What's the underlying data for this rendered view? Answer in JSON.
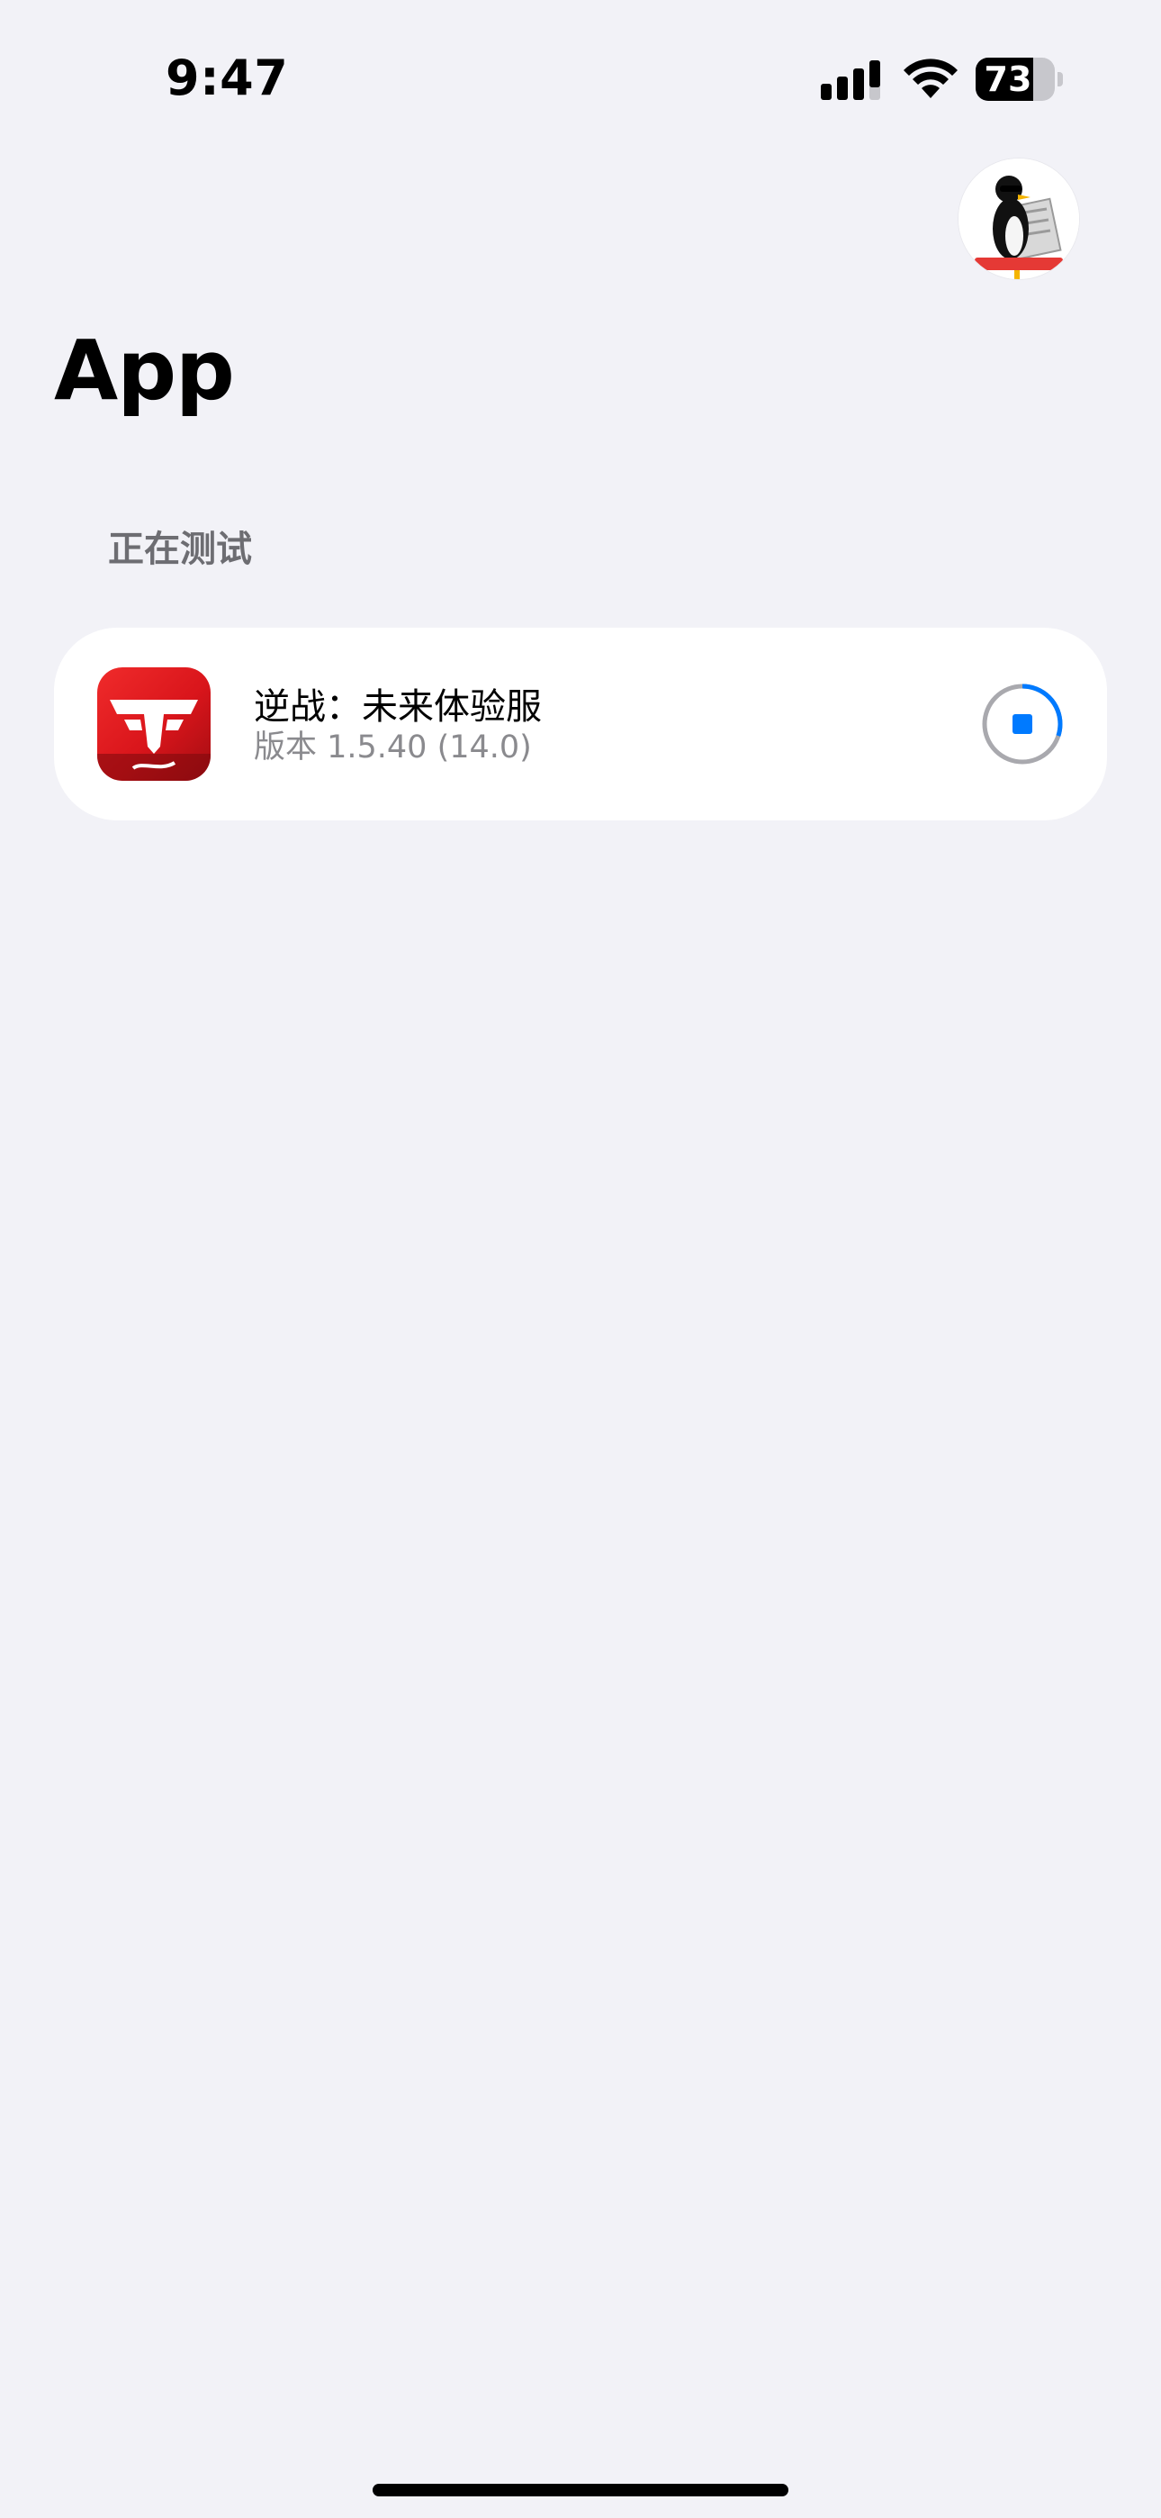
{
  "status_bar": {
    "time": "9:47",
    "battery_percent": "73",
    "battery_level": 0.73,
    "icons": [
      "cellular-signal-icon",
      "wifi-icon",
      "battery-icon"
    ]
  },
  "header": {
    "title": "App",
    "avatar_icon": "penguin-avatar-icon"
  },
  "section": {
    "label": "正在测试"
  },
  "apps": [
    {
      "name": "逆战：未来体验服",
      "version": "版本 1.5.40 (14.0)",
      "icon": "app-icon",
      "status_icon": "download-progress-stop-icon",
      "progress": 0.3
    }
  ],
  "colors": {
    "background": "#f2f2f7",
    "card": "#ffffff",
    "accent": "#007aff",
    "secondary_text": "#8a8a8e",
    "app_icon_red": "#d9151b"
  }
}
